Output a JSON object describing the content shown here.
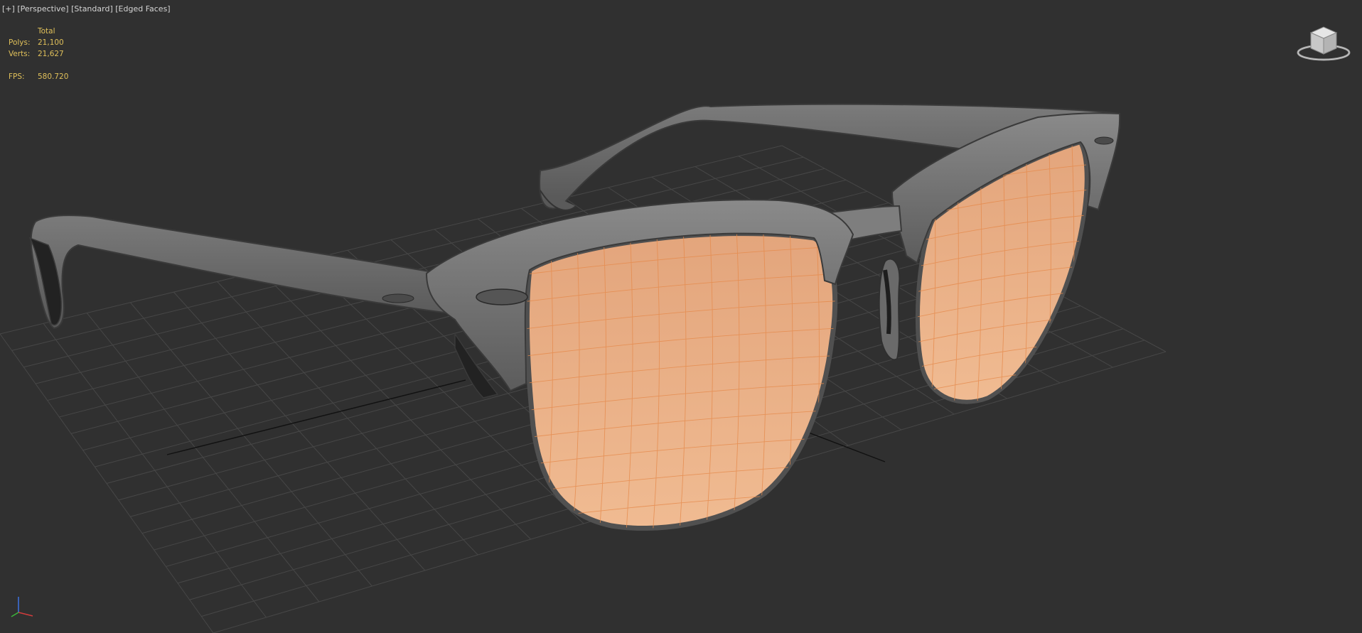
{
  "viewport": {
    "menu_plus": "[+]",
    "view_label": "[Perspective]",
    "shading_label": "[Standard]",
    "edge_label": "[Edged Faces]"
  },
  "stats": {
    "header": "Total",
    "polys_label": "Polys:",
    "polys_value": "21,100",
    "verts_label": "Verts:",
    "verts_value": "21,627",
    "fps_label": "FPS:",
    "fps_value": "580.720"
  },
  "colors": {
    "background": "#303030",
    "grid": "#474747",
    "frame": "#6e6e6e",
    "lens": "#e8a97c",
    "lens_wire": "#e58a4c",
    "stats_text": "#e0c05a"
  },
  "icons": {
    "viewcube": "viewcube-icon",
    "axis": "axis-tripod-icon"
  }
}
